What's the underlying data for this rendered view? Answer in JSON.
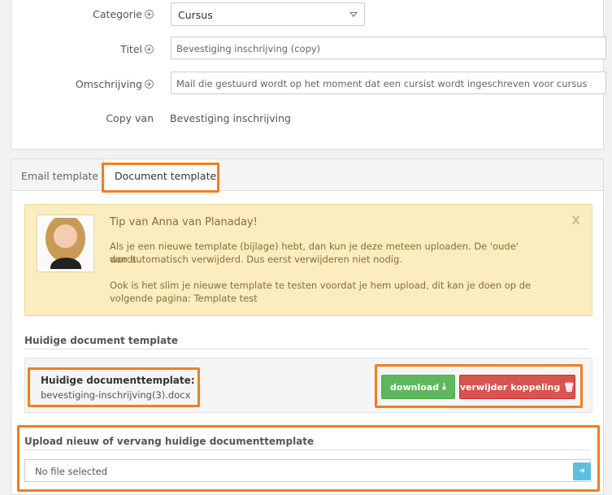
{
  "form": {
    "category_label": "Categorie",
    "category_value": "Cursus",
    "title_label": "Titel",
    "title_value": "Bevestiging inschrijving (copy)",
    "description_label": "Omschrijving",
    "description_value": "Mail die gestuurd wordt op het moment dat een cursist wordt ingeschreven voor cursus",
    "copy_label": "Copy van",
    "copy_value": "Bevestiging inschrijving"
  },
  "tabs": [
    {
      "label": "Email template",
      "active": false
    },
    {
      "label": "Document template",
      "active": true
    }
  ],
  "tip": {
    "title": "Tip van Anna van Planaday!",
    "close": "X",
    "line1": "Als je een nieuwe template (bijlage) hebt, dan kun je deze meteen uploaden. De 'oude' wordt",
    "line2": "dan automatisch verwijderd. Dus eerst verwijderen niet nodig.",
    "line3": "Ook is het slim je nieuwe template te testen voordat je hem upload, dit kan je doen op de",
    "line4_prefix": "volgende pagina:",
    "link": "Template test"
  },
  "current": {
    "section_title": "Huidige document template",
    "label": "Huidige documenttemplate:",
    "filename": "bevestiging-inschrijving(3).docx",
    "download_label": "download",
    "unlink_label": "verwijder koppeling"
  },
  "upload": {
    "section_title": "Upload nieuw of vervang huidige documenttemplate",
    "file_status": "No file selected"
  },
  "colors": {
    "highlight": "#f07f1e",
    "download": "#5cb85c",
    "unlink": "#d9534f",
    "tip_bg": "#fbedbd"
  }
}
